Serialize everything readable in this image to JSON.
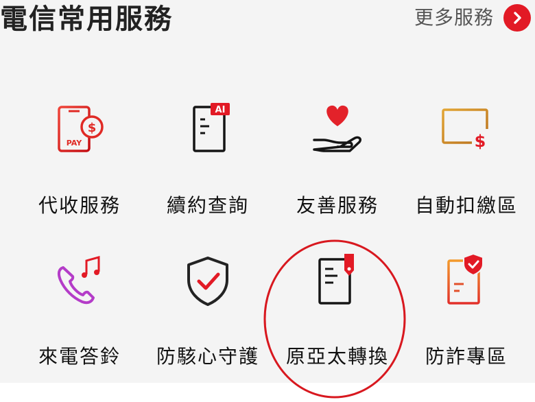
{
  "header": {
    "title": "電信常用服務",
    "more_label": "更多服務",
    "more_icon": "chevron-right-icon",
    "accent_color": "#e21a25"
  },
  "services": [
    {
      "label": "代收服務",
      "icon": "payment-phone-icon"
    },
    {
      "label": "續約查詢",
      "icon": "ai-document-icon"
    },
    {
      "label": "友善服務",
      "icon": "heart-hand-icon"
    },
    {
      "label": "自動扣繳區",
      "icon": "card-dollar-icon"
    },
    {
      "label": "來電答鈴",
      "icon": "phone-music-icon"
    },
    {
      "label": "防駭心守護",
      "icon": "shield-check-icon"
    },
    {
      "label": "原亞太轉換",
      "icon": "document-tag-icon"
    },
    {
      "label": "防詐專區",
      "icon": "document-shield-icon"
    }
  ],
  "highlighted_service": "原亞太轉換"
}
